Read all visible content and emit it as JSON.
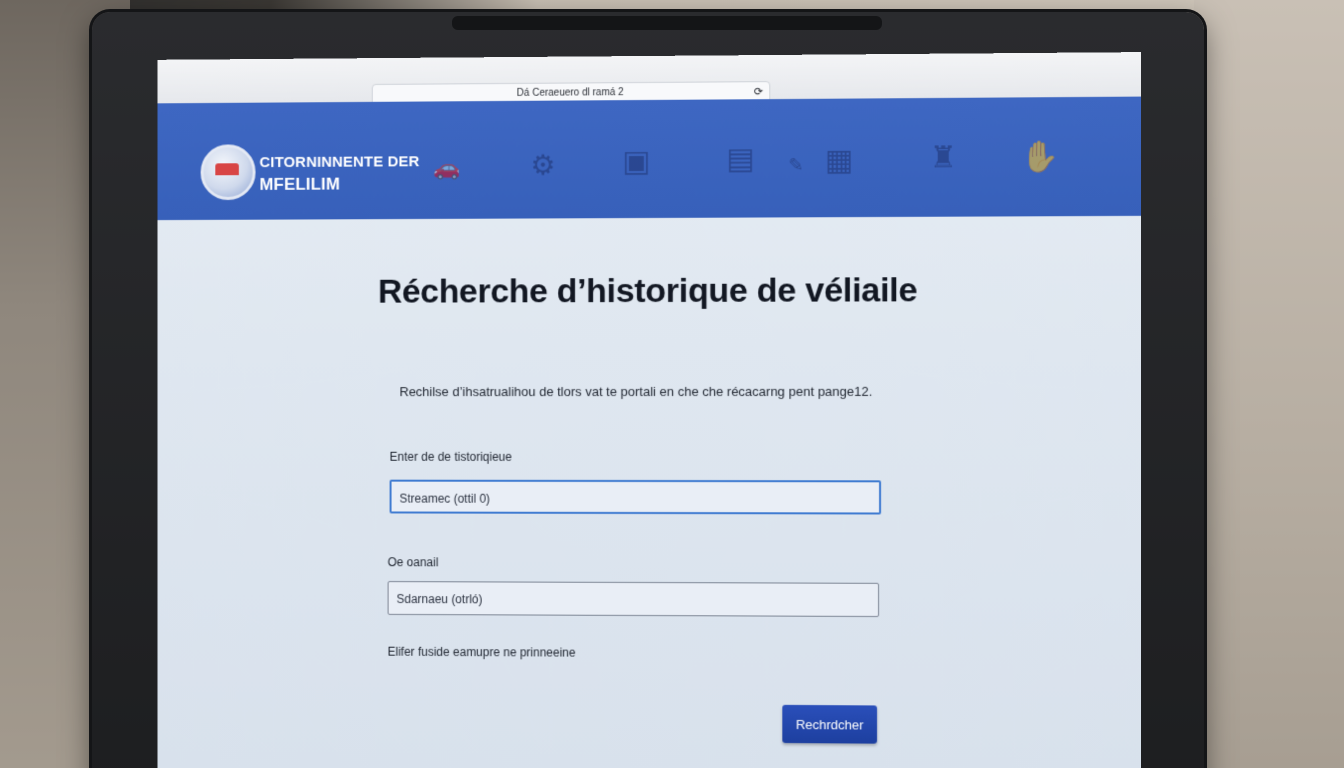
{
  "browser": {
    "address_text": "Dá Ceraeuero dl ramá 2",
    "address_icon": "reload-icon",
    "close_glyph": "×"
  },
  "header": {
    "logo_line1": "CITORNINNENTE DER",
    "logo_line2": "MFELILIM"
  },
  "main": {
    "title": "Récherche d’historique de véliaile",
    "intro": "Rechilse d’ihsatrualihou de tlors vat te portali en che che récacarng pent pange12.",
    "field1_label": "Enter de de tistoriqieue",
    "field1_value": "Streamec (ottil 0)",
    "field2_label": "Oe oanail",
    "field2_value": "Sdarnaeu (otrló)",
    "hint": "Elifer fuside eamupre ne prinneeine",
    "search_button": "Rechrdcher"
  },
  "colors": {
    "header_blue": "#3e67c2",
    "button_blue": "#1d3f9f",
    "focus_border": "#3f7bd1"
  }
}
